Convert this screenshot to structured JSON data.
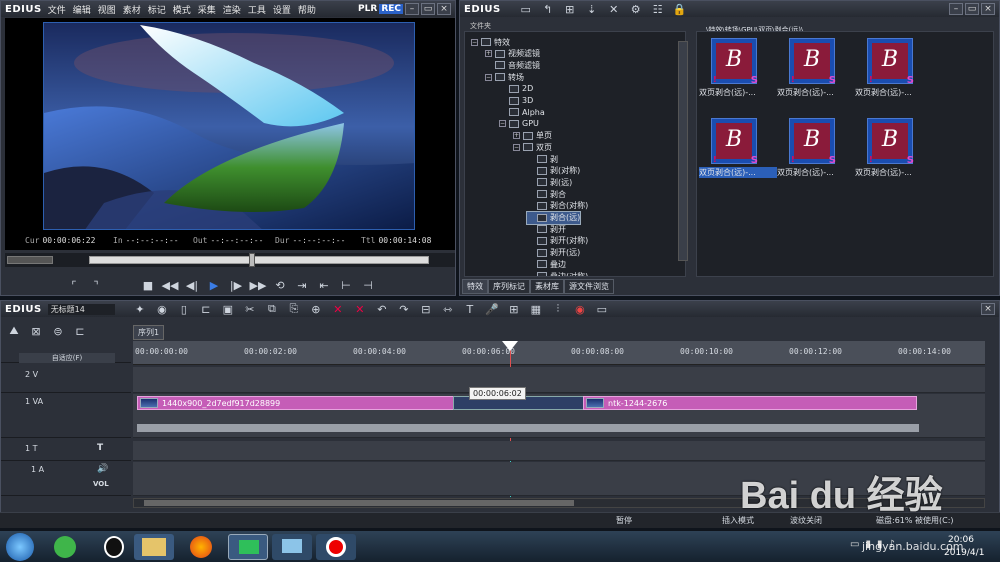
{
  "player": {
    "brand": "EDIUS",
    "menu": [
      "文件",
      "编辑",
      "视图",
      "素材",
      "标记",
      "模式",
      "采集",
      "渲染",
      "工具",
      "设置",
      "帮助"
    ],
    "plr": "PLR",
    "rec": "REC",
    "cur_label": "Cur",
    "cur": "00:00:06:22",
    "in_label": "In",
    "in": "--:--:--:--",
    "out_label": "Out",
    "out": "--:--:--:--",
    "dur_label": "Dur",
    "dur": "--:--:--:--",
    "ttl_label": "Ttl",
    "ttl": "00:00:14:08"
  },
  "library": {
    "brand": "EDIUS",
    "folder_header": "文件夹",
    "path": "\\特效\\转场\\GPU\\双页\\剥合(远)\\",
    "tree": [
      {
        "label": "特效",
        "level": 0,
        "exp": "−"
      },
      {
        "label": "视频滤镜",
        "level": 1,
        "exp": "+"
      },
      {
        "label": "音频滤镜",
        "level": 1,
        "exp": ""
      },
      {
        "label": "转场",
        "level": 1,
        "exp": "−"
      },
      {
        "label": "2D",
        "level": 2,
        "exp": ""
      },
      {
        "label": "3D",
        "level": 2,
        "exp": ""
      },
      {
        "label": "Alpha",
        "level": 2,
        "exp": ""
      },
      {
        "label": "GPU",
        "level": 2,
        "exp": "−"
      },
      {
        "label": "单页",
        "level": 3,
        "exp": "+"
      },
      {
        "label": "双页",
        "level": 3,
        "exp": "−"
      },
      {
        "label": "剥",
        "level": 4,
        "exp": ""
      },
      {
        "label": "剥(对称)",
        "level": 4,
        "exp": ""
      },
      {
        "label": "剥(远)",
        "level": 4,
        "exp": ""
      },
      {
        "label": "剥合",
        "level": 4,
        "exp": ""
      },
      {
        "label": "剥合(对称)",
        "level": 4,
        "exp": ""
      },
      {
        "label": "剥合(远)",
        "level": 4,
        "exp": "",
        "selected": true
      },
      {
        "label": "剥开",
        "level": 4,
        "exp": ""
      },
      {
        "label": "剥开(对称)",
        "level": 4,
        "exp": ""
      },
      {
        "label": "剥开(远)",
        "level": 4,
        "exp": ""
      },
      {
        "label": "叠边",
        "level": 4,
        "exp": ""
      },
      {
        "label": "叠边(对称)",
        "level": 4,
        "exp": ""
      }
    ],
    "tabs": [
      "特效",
      "序列标记",
      "素材库",
      "源文件浏览"
    ],
    "items": [
      {
        "label": "双页剥合(远)-..."
      },
      {
        "label": "双页剥合(远)-..."
      },
      {
        "label": "双页剥合(远)-..."
      },
      {
        "label": "双页剥合(远)-...",
        "selected": true
      },
      {
        "label": "双页剥合(远)-..."
      },
      {
        "label": "双页剥合(远)-..."
      }
    ],
    "thumb_letter": "B",
    "thumb_badge": "S"
  },
  "timeline": {
    "brand": "EDIUS",
    "project": "无标题14",
    "sequence_tab": "序列1",
    "mode_label": "自适应(F)",
    "ruler": [
      "00:00:00:00",
      "00:00:02:00",
      "00:00:04:00",
      "00:00:06:00",
      "00:00:08:00",
      "00:00:10:00",
      "00:00:12:00",
      "00:00:14:00"
    ],
    "tracks": {
      "v2": "2 V",
      "va1": "1 VA",
      "t1": "1 T",
      "a1": "1 A",
      "vol": "VOL"
    },
    "clip1": "1440x900_2d7edf917d28899",
    "clip2": "ntk-1244-2676",
    "tooltip": "00:00:06:02"
  },
  "status": {
    "pause": "暂停",
    "insert": "插入模式",
    "ripple": "波纹关闭",
    "disk": "磁盘:61% 被使用(C:)"
  },
  "taskbar": {
    "time": "20:06",
    "date": "2019/4/1"
  },
  "watermark": {
    "brand": "Bai du 经验",
    "url": "jingyan.baidu.com"
  }
}
